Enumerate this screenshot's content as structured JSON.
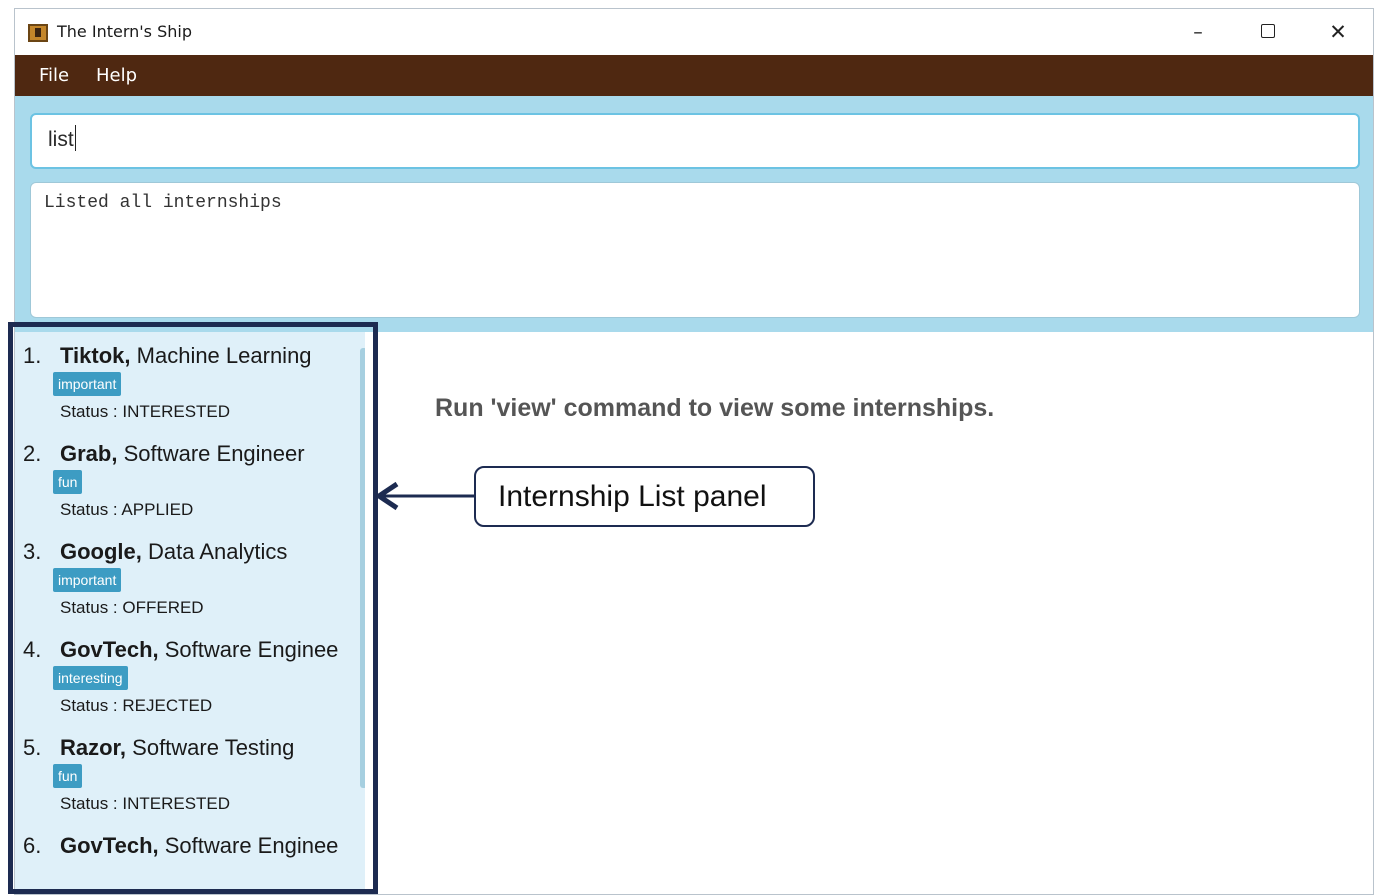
{
  "window": {
    "title": "The Intern's Ship"
  },
  "menu": [
    "File",
    "Help"
  ],
  "command_box": {
    "value": "list"
  },
  "result_display": {
    "text": "Listed all internships"
  },
  "internships": [
    {
      "index": "1.",
      "company": "Tiktok,",
      "role": "Machine Learning",
      "tag": "important",
      "status": "Status : INTERESTED"
    },
    {
      "index": "2.",
      "company": "Grab,",
      "role": "Software Engineer",
      "tag": "fun",
      "status": "Status : APPLIED"
    },
    {
      "index": "3.",
      "company": "Google,",
      "role": "Data Analytics",
      "tag": "important",
      "status": "Status : OFFERED"
    },
    {
      "index": "4.",
      "company": "GovTech,",
      "role": "Software Enginee",
      "tag": "interesting",
      "status": "Status : REJECTED"
    },
    {
      "index": "5.",
      "company": "Razor,",
      "role": "Software Testing",
      "tag": "fun",
      "status": "Status : INTERESTED"
    },
    {
      "index": "6.",
      "company": "GovTech,",
      "role": "Software Enginee",
      "tag": "",
      "status": ""
    }
  ],
  "view_panel": {
    "hint": "Run 'view' command to view some internships."
  },
  "annotation": {
    "label": "Internship List panel"
  },
  "colors": {
    "menubar": "#4f2811",
    "top_area": "#a9daec",
    "list_bg": "#dff0f9",
    "tag_bg": "#3d9cc3",
    "annotation_frame": "#1d2b51"
  }
}
